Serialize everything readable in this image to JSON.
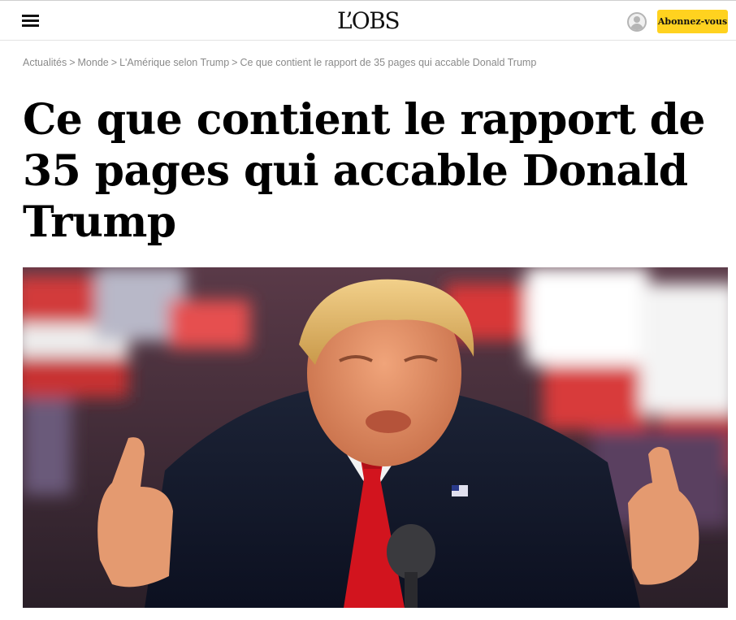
{
  "header": {
    "logo": "L’OBS",
    "subscribe_label": "Abonnez-vous"
  },
  "breadcrumb": [
    "Actualités",
    "Monde",
    "L'Amérique selon Trump",
    "Ce que contient le rapport de 35 pages qui accable Donald Trump"
  ],
  "breadcrumb_separator": ">",
  "article": {
    "headline": "Ce que contient le rapport de 35 pages qui accable Donald Trump"
  },
  "icons": {
    "menu": "hamburger-menu-icon",
    "account": "user-account-icon"
  },
  "colors": {
    "subscribe_bg": "#ffd21f",
    "breadcrumb_text": "#8a8a8a",
    "headline_text": "#000000"
  }
}
